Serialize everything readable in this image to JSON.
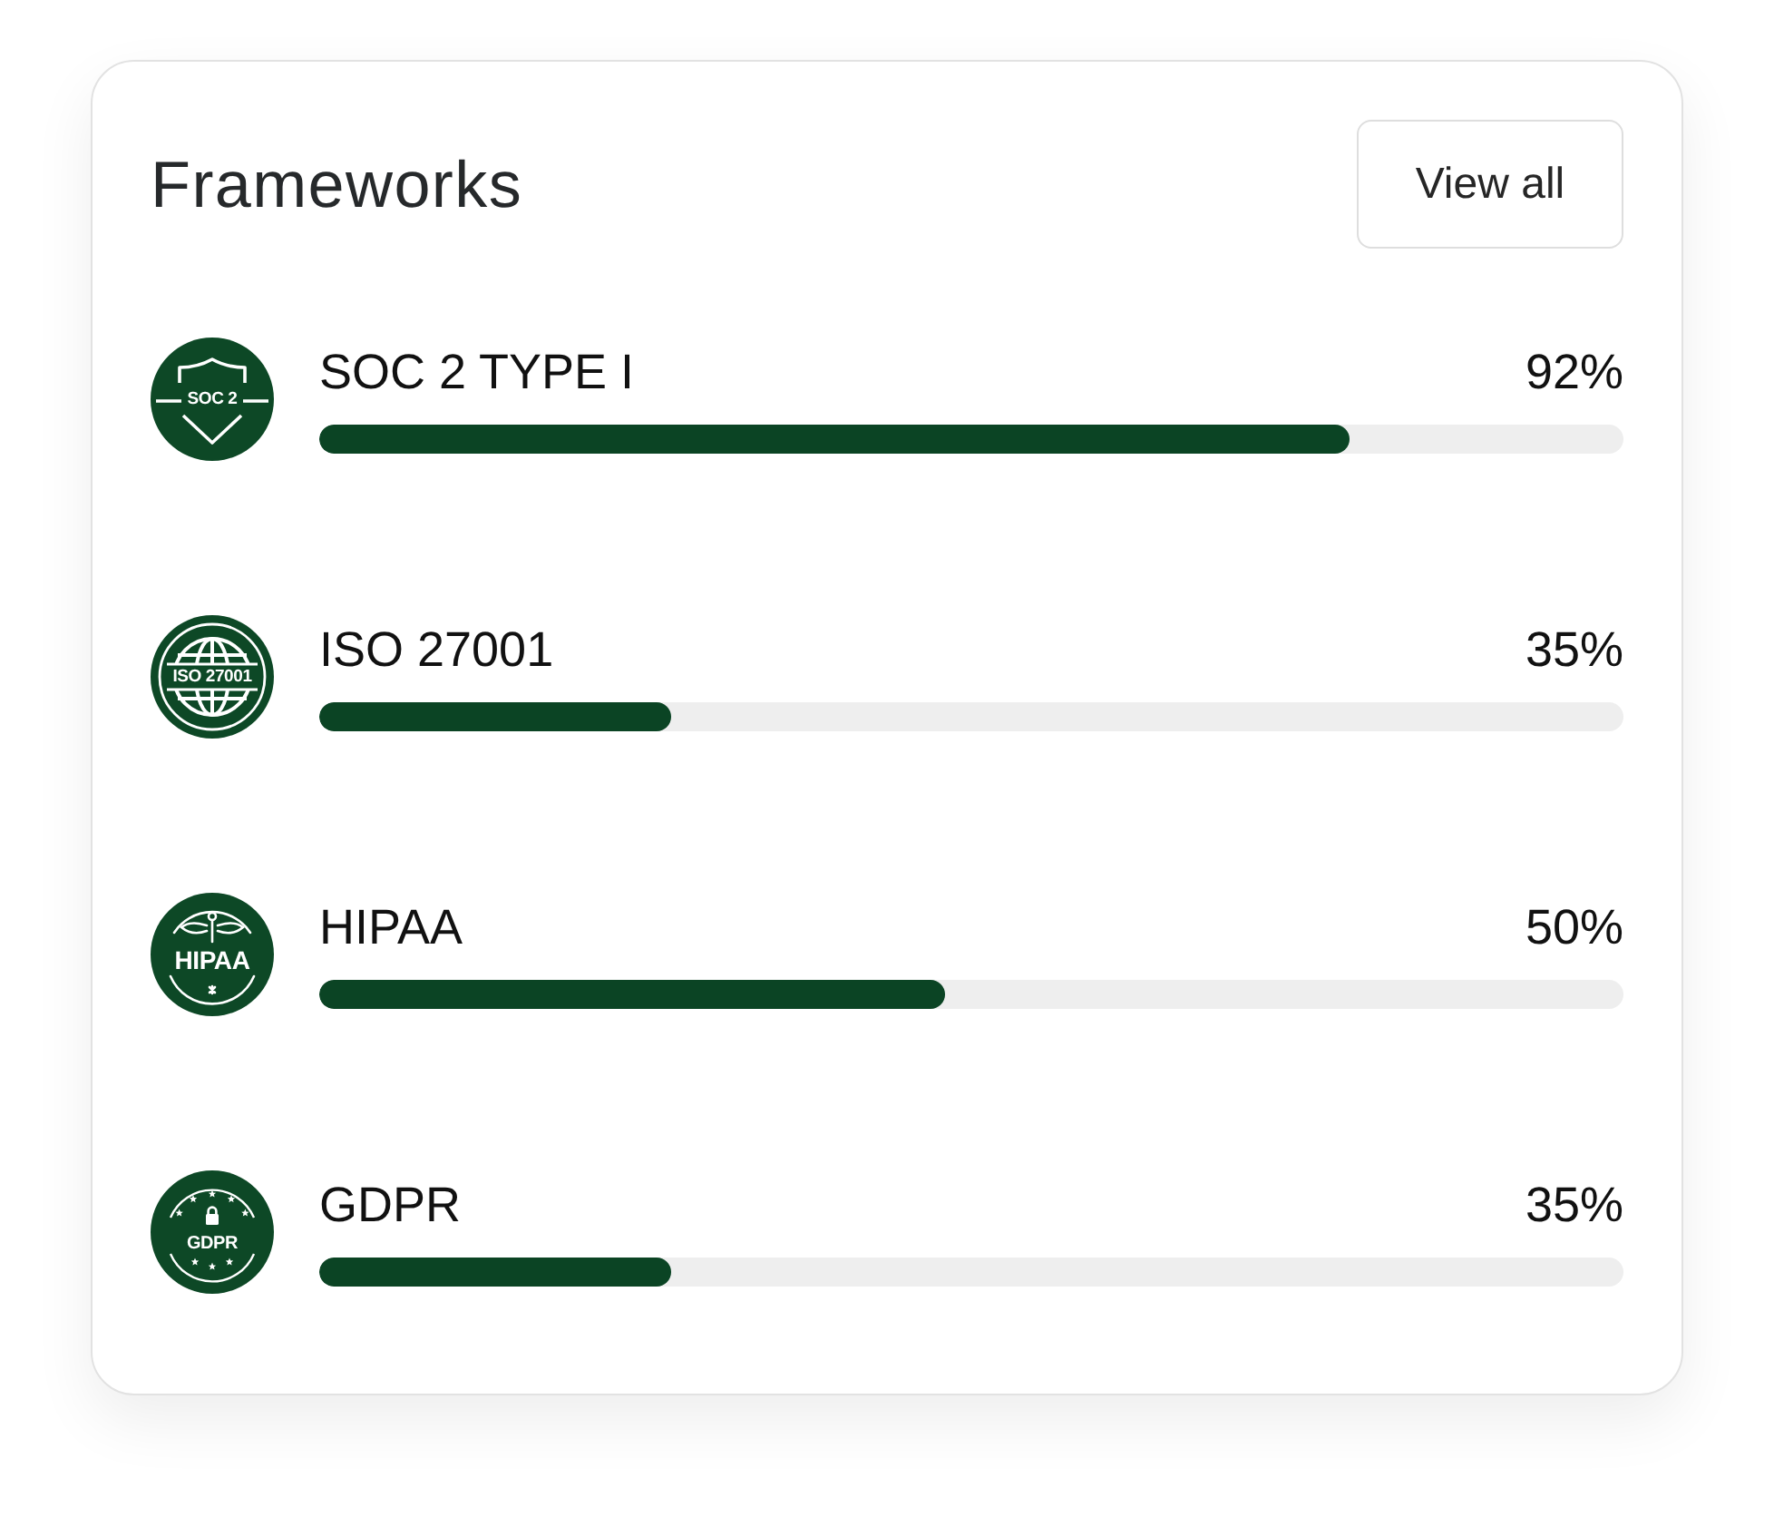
{
  "card": {
    "title": "Frameworks",
    "view_all_button": "View all"
  },
  "frameworks": [
    {
      "name": "SOC 2 TYPE I",
      "percent": "92%",
      "level": 0.79,
      "badge": {
        "kind": "shield",
        "label": "SOC 2"
      }
    },
    {
      "name": "ISO 27001",
      "percent": "35%",
      "level": 0.27,
      "badge": {
        "kind": "globe",
        "label": "ISO 27001"
      }
    },
    {
      "name": "HIPAA",
      "percent": "50%",
      "level": 0.48,
      "badge": {
        "kind": "wings",
        "label": "HIPAA"
      }
    },
    {
      "name": "GDPR",
      "percent": "35%",
      "level": 0.27,
      "badge": {
        "kind": "stars",
        "label": "GDPR"
      }
    }
  ]
}
